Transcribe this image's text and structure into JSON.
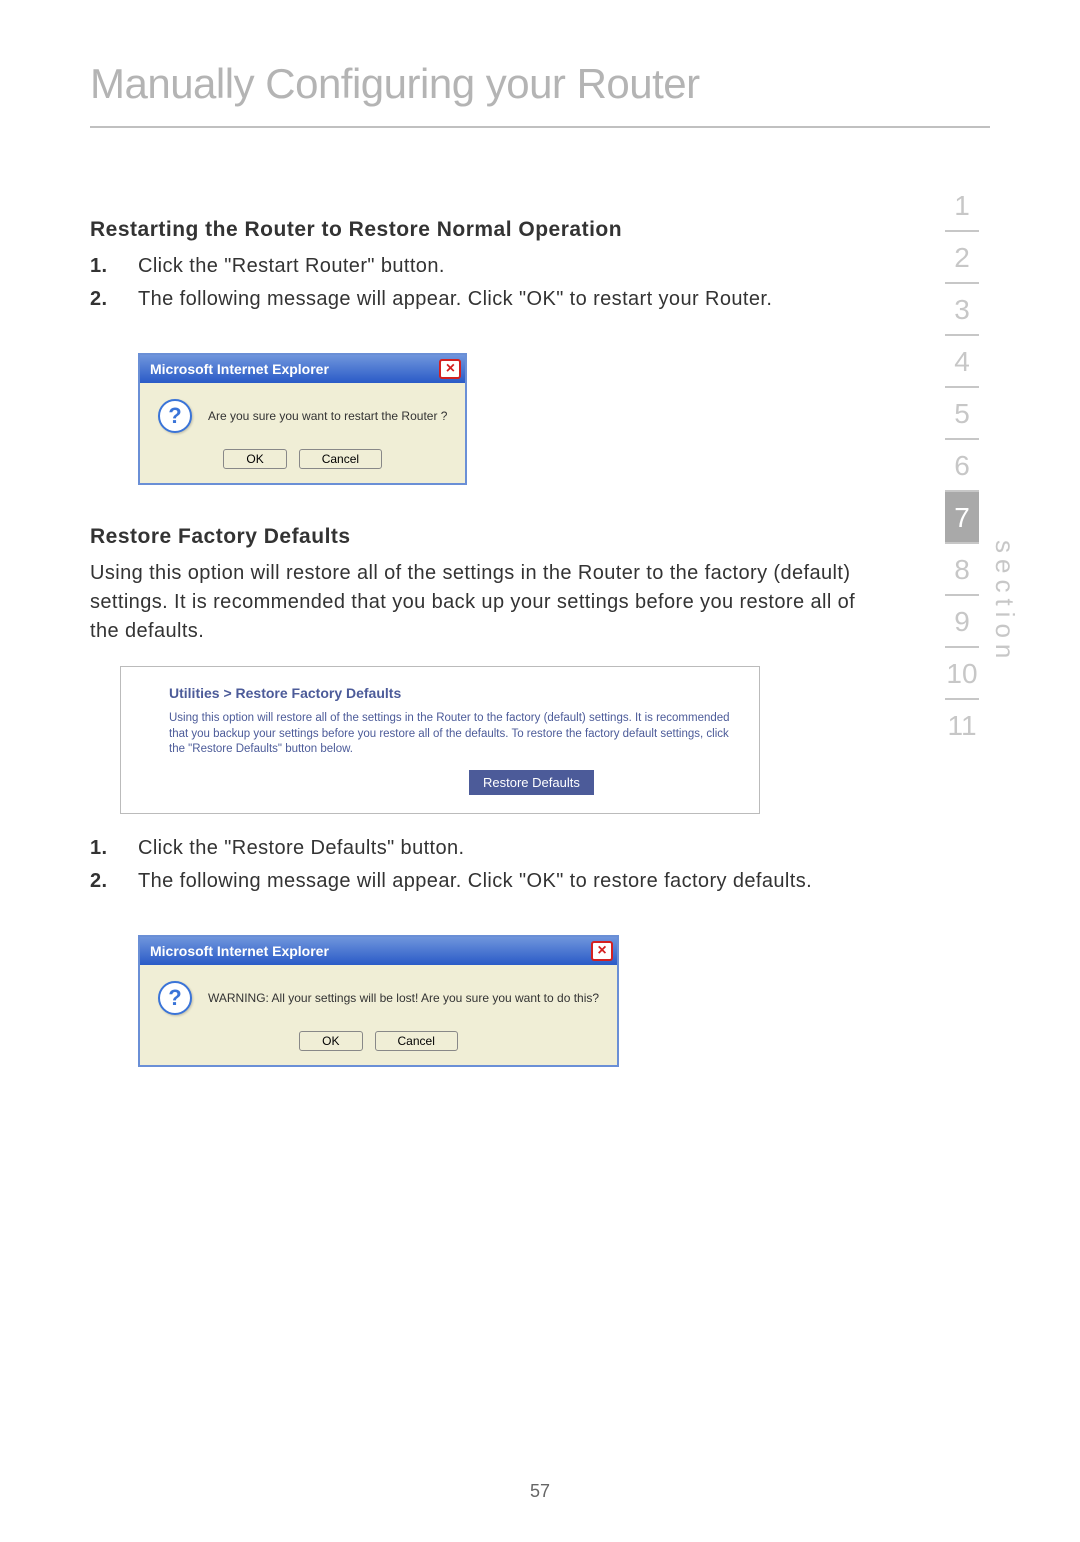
{
  "page_title": "Manually Configuring your Router",
  "section1": {
    "heading": "Restarting the Router to Restore Normal Operation",
    "steps": [
      "Click the \"Restart Router\" button.",
      "The following message will appear. Click \"OK\" to restart your Router."
    ]
  },
  "dialog1": {
    "title": "Microsoft Internet Explorer",
    "message": "Are you sure you want to restart the Router ?",
    "ok": "OK",
    "cancel": "Cancel"
  },
  "section2": {
    "heading": "Restore Factory Defaults",
    "intro": "Using this option will restore all of the settings in the Router to the factory (default) settings. It is recommended that you back up your settings before you restore all of the defaults."
  },
  "panel": {
    "breadcrumb": "Utilities > Restore Factory Defaults",
    "text": "Using this option will restore all of the settings in the Router to the factory (default) settings. It is recommended that you backup your settings before you restore all of the defaults. To restore the factory default settings, click the \"Restore Defaults\" button below.",
    "button": "Restore Defaults"
  },
  "section3": {
    "steps": [
      "Click the \"Restore Defaults\" button.",
      "The following message will appear. Click \"OK\" to restore factory defaults."
    ]
  },
  "dialog2": {
    "title": "Microsoft Internet Explorer",
    "message": "WARNING: All your settings will be lost! Are you sure you want to do this?",
    "ok": "OK",
    "cancel": "Cancel"
  },
  "sidebar": {
    "items": [
      "1",
      "2",
      "3",
      "4",
      "5",
      "6",
      "7",
      "8",
      "9",
      "10",
      "11"
    ],
    "active_index": 6,
    "label": "section"
  },
  "page_number": "57"
}
